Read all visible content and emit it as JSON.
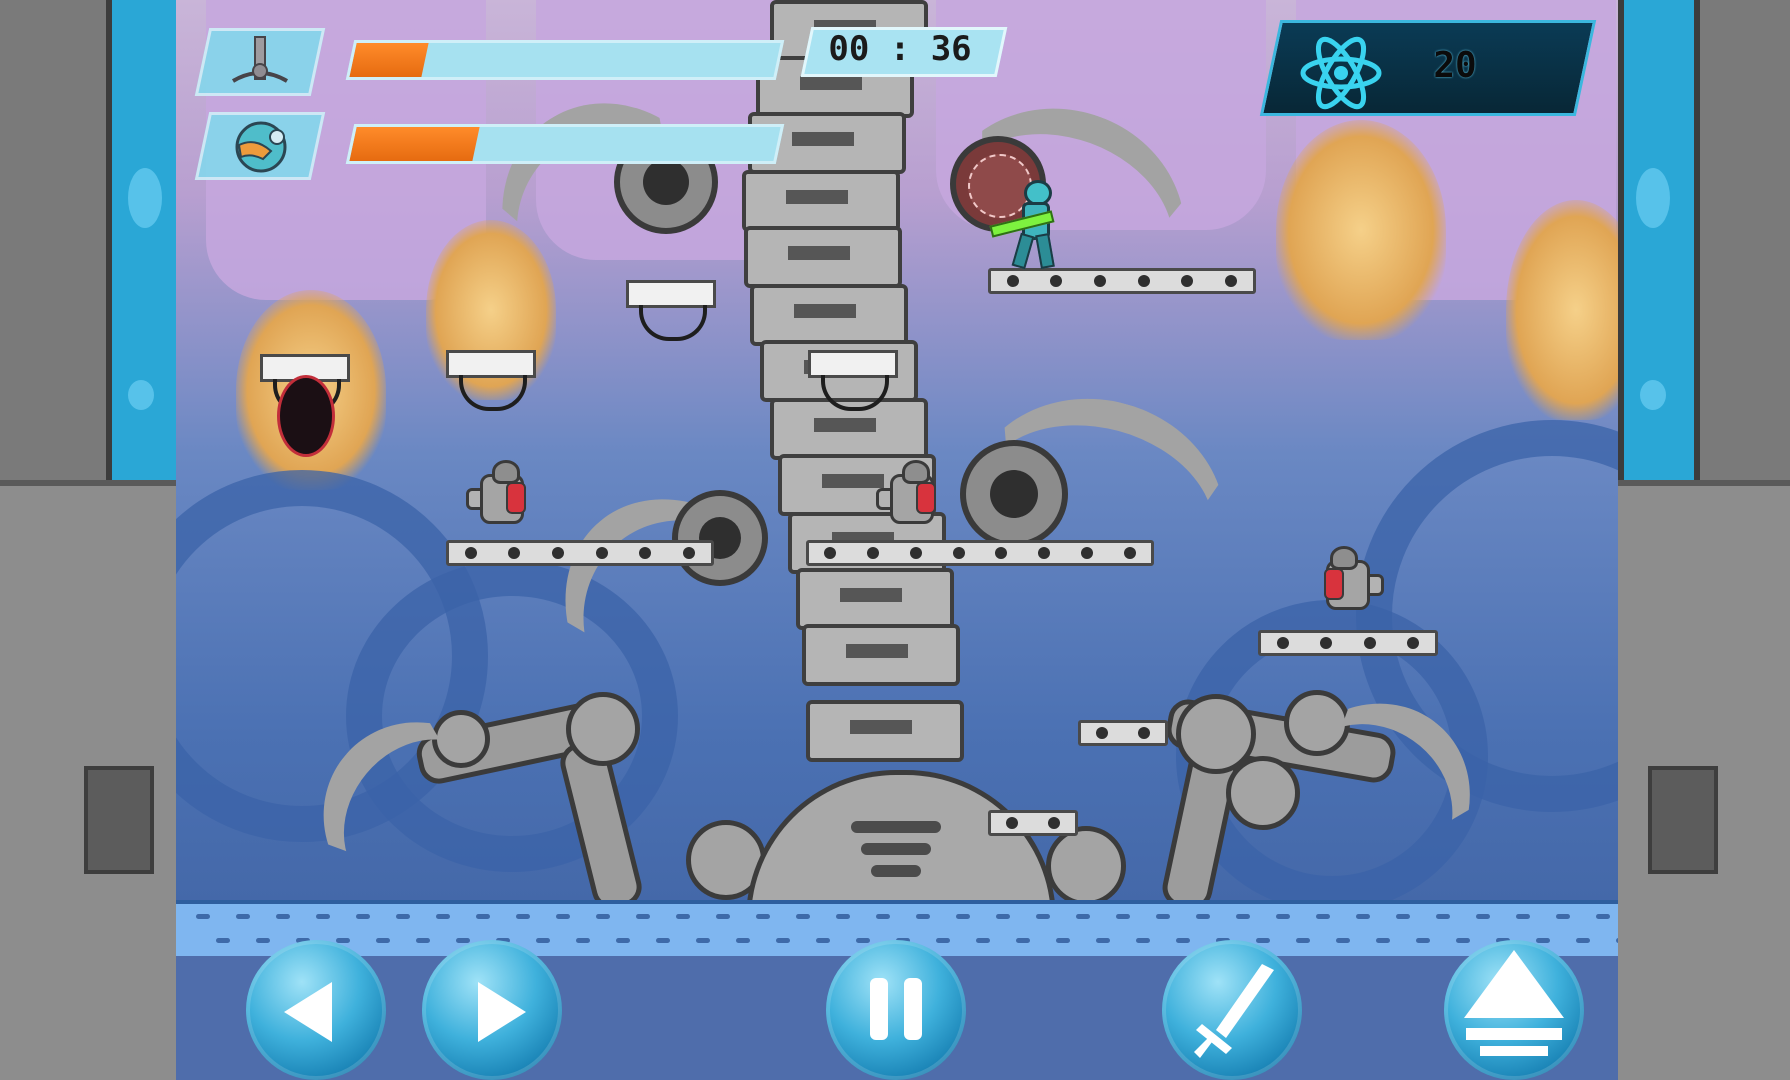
{
  "hud": {
    "boss_portrait_icon": "robot-scorpion-icon",
    "player_portrait_icon": "player-helmet-icon",
    "boss_health": 0.17,
    "player_health": 0.29,
    "timer": "00 : 36",
    "score_icon": "atom-icon",
    "score": "20"
  },
  "controls": {
    "left_icon": "arrow-left-icon",
    "right_icon": "arrow-right-icon",
    "pause_icon": "pause-icon",
    "attack_icon": "sword-icon",
    "jump_icon": "eject-jump-icon"
  },
  "colors": {
    "health_fill": "#f07a1c",
    "bar_bg": "#a6e1f0",
    "score_panel": "#0a3b55",
    "button_blue": "#3fb1dc",
    "floor_blue": "#7fb6f0"
  }
}
